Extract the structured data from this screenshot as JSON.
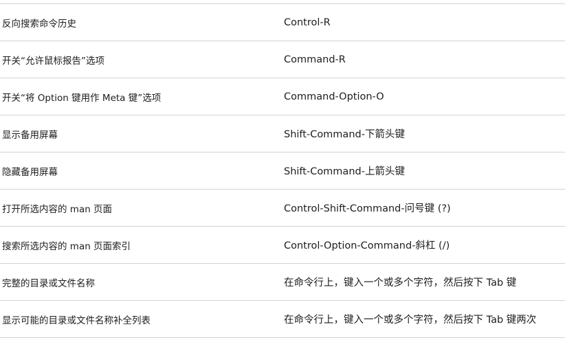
{
  "rows": [
    {
      "action": "反向搜索命令历史",
      "shortcut": "Control-R"
    },
    {
      "action": "开关“允许鼠标报告”选项",
      "shortcut": "Command-R"
    },
    {
      "action": "开关“将 Option 键用作 Meta 键”选项",
      "shortcut": "Command-Option-O"
    },
    {
      "action": "显示备用屏幕",
      "shortcut": "Shift-Command-下箭头键"
    },
    {
      "action": "隐藏备用屏幕",
      "shortcut": "Shift-Command-上箭头键"
    },
    {
      "action": "打开所选内容的 man 页面",
      "shortcut": "Control-Shift-Command-问号键 (?)"
    },
    {
      "action": "搜索所选内容的 man 页面索引",
      "shortcut": "Control-Option-Command-斜杠 (/)"
    },
    {
      "action": "完整的目录或文件名称",
      "shortcut": "在命令行上，键入一个或多个字符，然后按下 Tab 键"
    },
    {
      "action": "显示可能的目录或文件名称补全列表",
      "shortcut": "在命令行上，键入一个或多个字符，然后按下 Tab 键两次"
    }
  ]
}
